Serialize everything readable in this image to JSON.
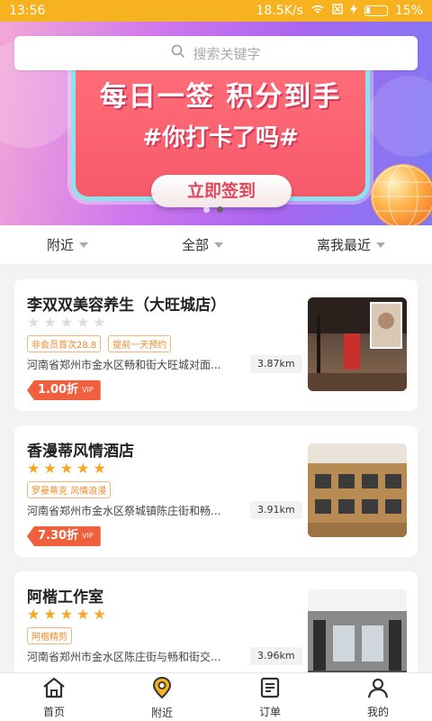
{
  "status_bar": {
    "time": "13:56",
    "speed": "18.5K/s",
    "battery": "15%"
  },
  "banner": {
    "headline": "每日一签  积分到手",
    "subline": "#你打卡了吗#",
    "cta": "立即签到",
    "active_dot": 2,
    "dot_count": 2
  },
  "search": {
    "placeholder": "搜索关键字"
  },
  "filters": [
    {
      "label": "附近"
    },
    {
      "label": "全部"
    },
    {
      "label": "离我最近"
    }
  ],
  "shops": [
    {
      "name": "李双双美容养生（大旺城店）",
      "rating": 0,
      "tags": [
        "非会员首次28.8",
        "提前一天预约"
      ],
      "address": "河南省郑州市金水区畅和街大旺城对面...",
      "distance": "3.87km",
      "discount": "1.00折",
      "vip": "VIP"
    },
    {
      "name": "香漫蒂风情酒店",
      "rating": 5,
      "tags": [
        "罗曼蒂克 风情浪漫"
      ],
      "address": "河南省郑州市金水区祭城镇陈庄街和畅...",
      "distance": "3.91km",
      "discount": "7.30折",
      "vip": "VIP"
    },
    {
      "name": "阿楷工作室",
      "rating": 5,
      "tags": [
        "阿楷精剪"
      ],
      "address": "河南省郑州市金水区陈庄街与畅和街交...",
      "distance": "3.96km",
      "discount": "",
      "vip": ""
    }
  ],
  "tabbar": [
    {
      "label": "首页",
      "icon": "home-icon"
    },
    {
      "label": "附近",
      "icon": "location-pin-icon",
      "active": true
    },
    {
      "label": "订单",
      "icon": "order-list-icon"
    },
    {
      "label": "我的",
      "icon": "user-icon"
    }
  ],
  "colors": {
    "accent": "#f6b21f",
    "discount": "#f0603c",
    "star": "#f6a623"
  }
}
